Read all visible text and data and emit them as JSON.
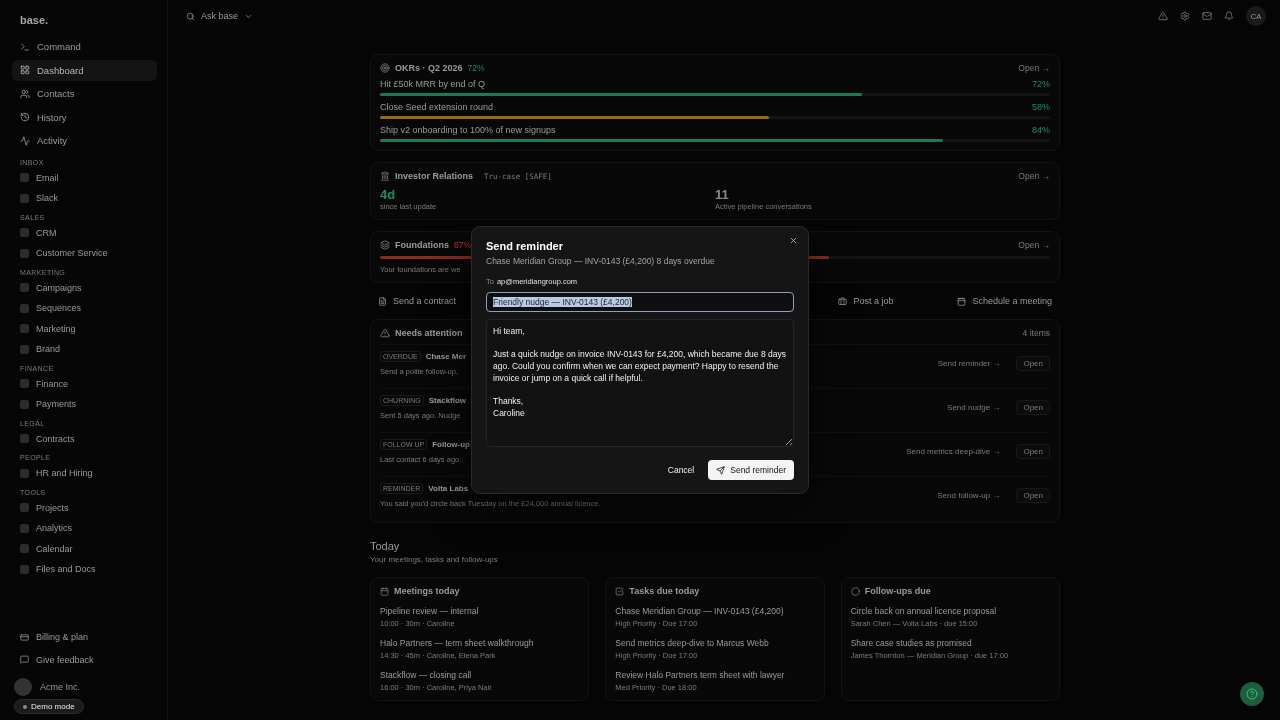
{
  "sidebar": {
    "logo": "base.",
    "nav": [
      {
        "label": "Command",
        "selected": false
      },
      {
        "label": "Dashboard",
        "selected": true
      },
      {
        "label": "Contacts",
        "selected": false
      },
      {
        "label": "History",
        "selected": false
      },
      {
        "label": "Activity",
        "selected": false
      }
    ],
    "groups": [
      {
        "heading": "INBOX",
        "items": [
          "Email",
          "Slack"
        ]
      },
      {
        "heading": "SALES",
        "items": [
          "CRM",
          "Customer Service"
        ]
      },
      {
        "heading": "MARKETING",
        "items": [
          "Campaigns",
          "Sequences",
          "Marketing",
          "Brand"
        ]
      },
      {
        "heading": "FINANCE",
        "items": [
          "Finance",
          "Payments"
        ]
      },
      {
        "heading": "LEGAL",
        "items": [
          "Contracts"
        ]
      },
      {
        "heading": "PEOPLE",
        "items": [
          "HR and Hiring"
        ]
      },
      {
        "heading": "TOOLS",
        "items": [
          "Projects",
          "Analytics",
          "Calendar",
          "Files and Docs"
        ]
      }
    ],
    "footer_links": [
      "Billing & plan",
      "Give feedback"
    ],
    "workspace": {
      "name": "Acme Inc."
    },
    "demo_badge": "Demo mode"
  },
  "topbar": {
    "search": {
      "placeholder": "Ask base"
    },
    "avatar": "CA"
  },
  "okrs": {
    "title": "OKRs · Q2 2026",
    "percent": "72%",
    "open": "Open →",
    "items": [
      {
        "label": "Hit £50k MRR by end of Q",
        "reading": "72%",
        "level": 0.72,
        "color": "#1b7a5a"
      },
      {
        "label": "Close Seed extension round",
        "reading": "58%",
        "level": 0.58,
        "color": "#9a6a1c"
      },
      {
        "label": "Ship v2 onboarding to 100% of new signups",
        "reading": "84%",
        "level": 0.84,
        "color": "#1b7a5a"
      }
    ]
  },
  "investor": {
    "title": "Investor Relations",
    "tag": "Tru-case [SAFE]",
    "open": "Open →",
    "stats": [
      {
        "value": "4d",
        "label": "since last update",
        "color": "#1f8a66"
      },
      {
        "value": "11",
        "label": "Active pipeline conversations",
        "color": "#8a8a8a"
      }
    ]
  },
  "foundations": {
    "title": "Foundations",
    "percent": "67%",
    "open": "Open →",
    "level": 0.67,
    "note": "Your foundations are we"
  },
  "quick_actions": [
    "Send a contract",
    "Post a job",
    "Schedule a meeting"
  ],
  "attention": {
    "title": "Needs attention",
    "count": "4 items",
    "rows": [
      {
        "tag": "OVERDUE",
        "title": "Chase Mer",
        "detail": "Send a polite follow-up,",
        "action": "Send reminder →",
        "open": "Open"
      },
      {
        "tag": "CHURNING",
        "title": "Stackflow",
        "detail": "Sent 5 days ago. Nudge",
        "action": "Send nudge →",
        "open": "Open"
      },
      {
        "tag": "FOLLOW UP",
        "title": "Follow-up",
        "detail": "Last contact 6 days ago.",
        "action": "Send metrics deep-dive →",
        "open": "Open"
      },
      {
        "tag": "REMINDER",
        "title": "Volta Labs",
        "detail": "You said you'd circle back Tuesday on the £24,000 annual licence.",
        "action": "Send follow-up →",
        "open": "Open"
      }
    ]
  },
  "today": {
    "title": "Today",
    "subtitle": "Your meetings, tasks and follow-ups",
    "cards": [
      {
        "title": "Meetings today",
        "entries": [
          {
            "title": "Pipeline review — internal",
            "meta": "10:00 · 30m · Caroline"
          },
          {
            "title": "Halo Partners — term sheet walkthrough",
            "meta": "14:30 · 45m · Caroline, Elena Park"
          },
          {
            "title": "Stackflow — closing call",
            "meta": "16:00 · 30m · Caroline, Priya Nair"
          }
        ]
      },
      {
        "title": "Tasks due today",
        "entries": [
          {
            "title": "Chase Meridian Group — INV-0143 (£4,200)",
            "meta": "High Priority · Due 17:00"
          },
          {
            "title": "Send metrics deep-dive to Marcus Webb",
            "meta": "High Priority · Due 17:00"
          },
          {
            "title": "Review Halo Partners term sheet with lawyer",
            "meta": "Med Priority · Due 18:00"
          }
        ]
      },
      {
        "title": "Follow-ups due",
        "entries": [
          {
            "title": "Circle back on annual licence proposal",
            "meta": "Sarah Chen — Volta Labs · due 15:00"
          },
          {
            "title": "Share case studies as promised",
            "meta": "James Thornton — Meridian Group · due 17:00"
          }
        ]
      }
    ]
  },
  "dialog": {
    "title": "Send reminder",
    "subtitle": "Chase Meridian Group — INV-0143 (£4,200) 8 days overdue",
    "to_label": "To",
    "to": "ap@meridiangroup.com",
    "subject": {
      "value": "Friendly nudge — INV-0143 (£4,200)",
      "text_selected": true
    },
    "body": "Hi team,\n\nJust a quick nudge on invoice INV-0143 for £4,200, which became due 8 days ago. Could you confirm when we can expect payment? Happy to resend the invoice or jump on a quick call if helpful.\n\nThanks,\nCaroline",
    "cancel": "Cancel",
    "send": "Send reminder"
  }
}
